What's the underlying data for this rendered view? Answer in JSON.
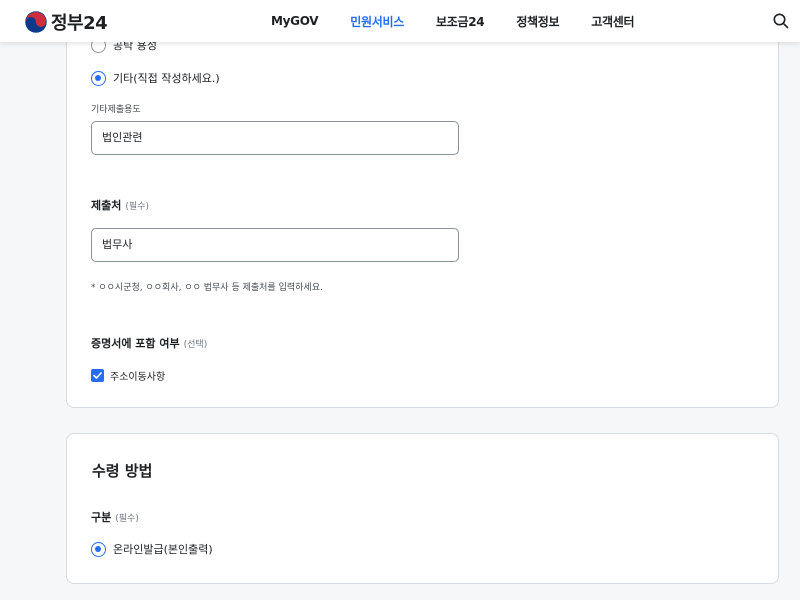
{
  "header": {
    "logo_text": "정부24",
    "nav": [
      {
        "label": "MyGOV",
        "active": false
      },
      {
        "label": "민원서비스",
        "active": true
      },
      {
        "label": "보조금24",
        "active": false
      },
      {
        "label": "정책정보",
        "active": false
      },
      {
        "label": "고객센터",
        "active": false
      }
    ],
    "search_icon": "search-icon"
  },
  "purpose": {
    "option_partial_label": "공탁 용성",
    "option_other_label": "기타(직접 작성하세요.)",
    "other_field_label": "기타제출용도",
    "other_field_value": "법인관련"
  },
  "submit_to": {
    "label": "제출처",
    "required": "(필수)",
    "value": "법무사",
    "hint": "* ㅇㅇ시군청, ㅇㅇ회사, ㅇㅇ 법무사 등 제출처를 입력하세요."
  },
  "include": {
    "label": "증명서에 포함 여부",
    "optional": "(선택)",
    "checkbox_label": "주소이동사항",
    "checked": true
  },
  "receive": {
    "title": "수령 방법",
    "type_label": "구분",
    "required": "(필수)",
    "option_label": "온라인발급(본인출력)"
  },
  "colors": {
    "accent": "#256ef4",
    "text": "#1e2124",
    "border": "#d6dce3",
    "background": "#f6f7f9"
  }
}
